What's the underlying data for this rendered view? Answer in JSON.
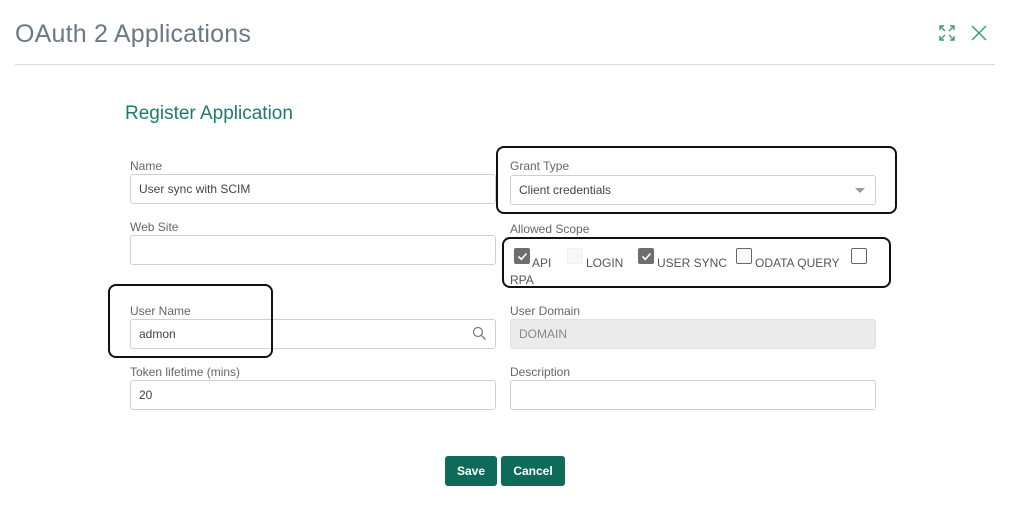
{
  "header": {
    "title": "OAuth 2 Applications",
    "expand_icon": "expand-icon",
    "close_icon": "close-icon"
  },
  "form": {
    "section_title": "Register Application",
    "name": {
      "label": "Name",
      "value": "User sync with SCIM"
    },
    "grant_type": {
      "label": "Grant Type",
      "value": "Client credentials"
    },
    "web_site": {
      "label": "Web Site",
      "value": ""
    },
    "allowed_scope": {
      "label": "Allowed Scope",
      "options": [
        {
          "label": "API",
          "checked": true
        },
        {
          "label": "LOGIN",
          "checked": false
        },
        {
          "label": "USER SYNC",
          "checked": true
        },
        {
          "label": "ODATA QUERY",
          "checked": false
        },
        {
          "label": "RPA",
          "checked": false
        }
      ]
    },
    "user_name": {
      "label": "User Name",
      "value": "admon"
    },
    "user_domain": {
      "label": "User Domain",
      "value": "DOMAIN"
    },
    "token_lifetime": {
      "label": "Token lifetime (mins)",
      "value": "20"
    },
    "description": {
      "label": "Description",
      "value": ""
    }
  },
  "buttons": {
    "save": "Save",
    "cancel": "Cancel"
  },
  "colors": {
    "accent": "#0e6b5a",
    "title": "#6b7885",
    "section": "#1f7a6a"
  }
}
